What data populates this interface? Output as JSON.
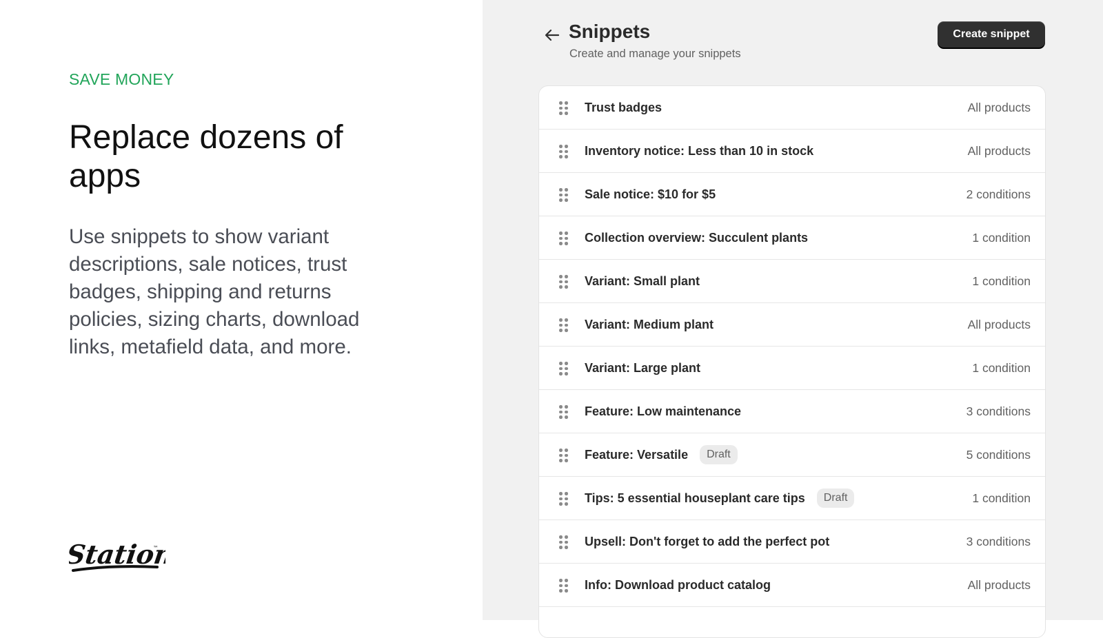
{
  "marketing": {
    "eyebrow": "SAVE MONEY",
    "headline": "Replace dozens of apps",
    "body": "Use snippets to show variant descriptions, sale notices, trust badges, shipping and returns policies, sizing charts, download links, metafield data, and more.",
    "logo_text": "Station",
    "logo_trademark": "™",
    "accent_color": "#22a55a"
  },
  "header": {
    "back_icon": "arrow-left-icon",
    "title": "Snippets",
    "subtitle": "Create and manage your snippets",
    "create_button": "Create snippet"
  },
  "snippets": [
    {
      "title": "Trust badges",
      "badge": null,
      "scope": "All products"
    },
    {
      "title": "Inventory notice: Less than 10 in stock",
      "badge": null,
      "scope": "All products"
    },
    {
      "title": "Sale notice: $10 for $5",
      "badge": null,
      "scope": "2 conditions"
    },
    {
      "title": "Collection overview: Succulent plants",
      "badge": null,
      "scope": "1 condition"
    },
    {
      "title": "Variant: Small plant",
      "badge": null,
      "scope": "1 condition"
    },
    {
      "title": "Variant: Medium plant",
      "badge": null,
      "scope": "All products"
    },
    {
      "title": "Variant: Large plant",
      "badge": null,
      "scope": "1 condition"
    },
    {
      "title": "Feature: Low maintenance",
      "badge": null,
      "scope": "3 conditions"
    },
    {
      "title": "Feature: Versatile",
      "badge": "Draft",
      "scope": "5 conditions"
    },
    {
      "title": "Tips: 5 essential houseplant care tips",
      "badge": "Draft",
      "scope": "1 condition"
    },
    {
      "title": "Upsell: Don't forget to add the perfect pot",
      "badge": null,
      "scope": "3 conditions"
    },
    {
      "title": "Info: Download product catalog",
      "badge": null,
      "scope": "All products"
    }
  ]
}
